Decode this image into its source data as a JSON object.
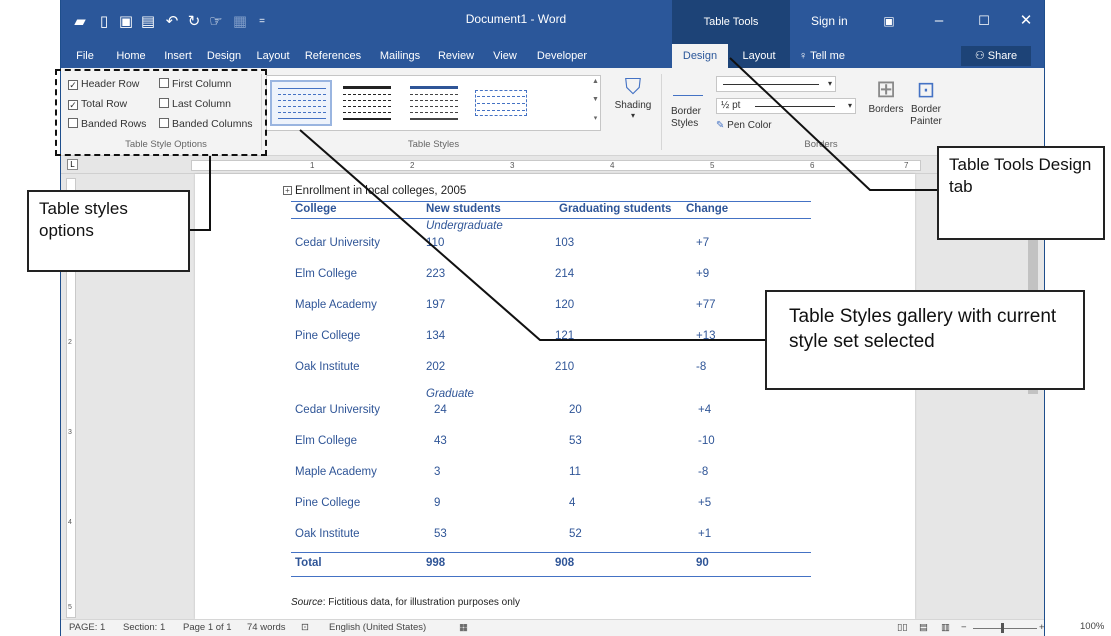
{
  "title_bar": {
    "document_title": "Document1 - Word",
    "contextual_group": "Table Tools",
    "sign_in": "Sign in"
  },
  "tabs": [
    "File",
    "Home",
    "Insert",
    "Design",
    "Layout",
    "References",
    "Mailings",
    "Review",
    "View",
    "Developer",
    "Design",
    "Layout"
  ],
  "tell_me": "Tell me",
  "share": "Share",
  "style_options": {
    "items": [
      {
        "label": "Header Row",
        "checked": true
      },
      {
        "label": "First Column",
        "checked": false
      },
      {
        "label": "Total Row",
        "checked": true
      },
      {
        "label": "Last Column",
        "checked": false
      },
      {
        "label": "Banded Rows",
        "checked": false
      },
      {
        "label": "Banded Columns",
        "checked": false
      }
    ],
    "group_label": "Table Style Options"
  },
  "table_styles": {
    "group_label": "Table Styles",
    "shading": "Shading"
  },
  "borders": {
    "border_styles": "Border Styles",
    "weight": "½ pt",
    "pen_color": "Pen Color",
    "borders_btn": "Borders",
    "border_painter": "Border Painter",
    "group_label": "Borders"
  },
  "document": {
    "caption": "Enrollment in local colleges, 2005",
    "headers": [
      "College",
      "New students",
      "Graduating students",
      "Change"
    ],
    "section_undergrad": "Undergraduate",
    "section_grad": "Graduate",
    "undergrad_rows": [
      [
        "Cedar University",
        "110",
        "103",
        "+7"
      ],
      [
        "Elm College",
        "223",
        "214",
        "+9"
      ],
      [
        "Maple Academy",
        "197",
        "120",
        "+77"
      ],
      [
        "Pine College",
        "134",
        "121",
        "+13"
      ],
      [
        "Oak Institute",
        "202",
        "210",
        "-8"
      ]
    ],
    "grad_rows": [
      [
        "Cedar University",
        "24",
        "20",
        "+4"
      ],
      [
        "Elm College",
        "43",
        "53",
        "-10"
      ],
      [
        "Maple Academy",
        "3",
        "11",
        "-8"
      ],
      [
        "Pine College",
        "9",
        "4",
        "+5"
      ],
      [
        "Oak Institute",
        "53",
        "52",
        "+1"
      ]
    ],
    "total_row": [
      "Total",
      "998",
      "908",
      "90"
    ],
    "source_label": "Source",
    "source_text": ": Fictitious data, for illustration purposes only"
  },
  "status_bar": {
    "page": "PAGE: 1",
    "section": "Section: 1",
    "page_of": "Page 1 of 1",
    "words": "74 words",
    "language": "English (United States)",
    "zoom": "100%"
  },
  "callouts": {
    "style_options": "Table styles options",
    "design_tab": "Table Tools Design tab",
    "gallery": "Table Styles gallery with current style set selected"
  },
  "ruler_numbers": [
    "1",
    "2",
    "3",
    "4",
    "5",
    "6",
    "7"
  ],
  "vruler_numbers": [
    "1",
    "2",
    "3",
    "4",
    "5"
  ]
}
